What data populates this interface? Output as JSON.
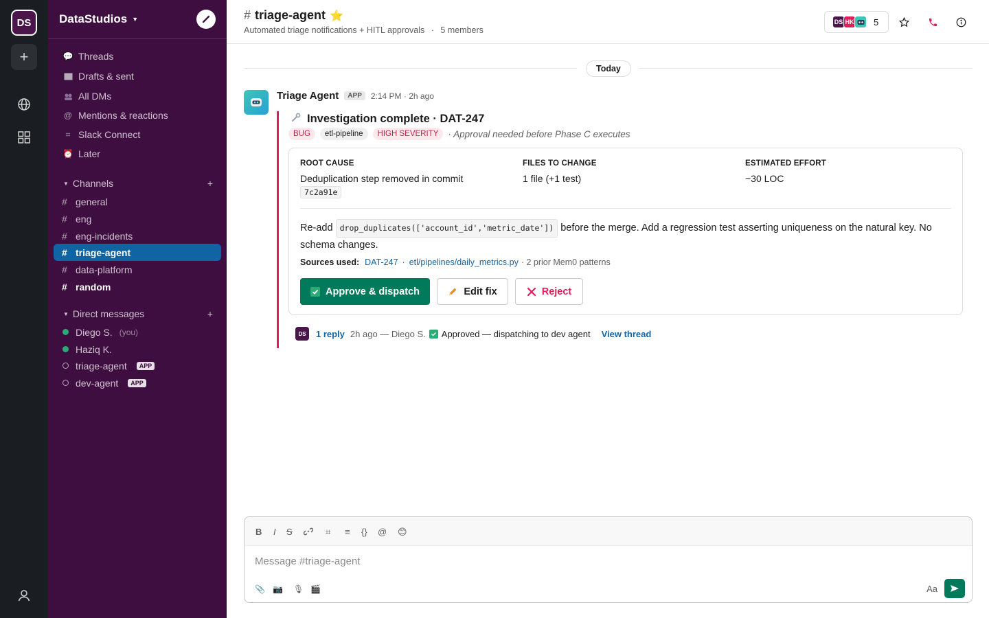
{
  "workspace": {
    "initials": "DS",
    "name": "DataStudios"
  },
  "sidebar": {
    "nav": [
      {
        "label": "Threads",
        "icon": "thread-icon"
      },
      {
        "label": "Drafts & sent",
        "icon": "drafts-icon"
      },
      {
        "label": "All DMs",
        "icon": "dms-icon"
      },
      {
        "label": "Mentions & reactions",
        "icon": "mention-icon"
      },
      {
        "label": "Slack Connect",
        "icon": "connect-icon"
      },
      {
        "label": "Later",
        "icon": "alarm-clock-icon"
      }
    ],
    "channels_title": "Channels",
    "channels": [
      {
        "name": "general"
      },
      {
        "name": "eng"
      },
      {
        "name": "eng-incidents"
      },
      {
        "name": "triage-agent"
      },
      {
        "name": "data-platform"
      },
      {
        "name": "random"
      }
    ],
    "dms_title": "Direct messages",
    "dms": [
      {
        "name": "Diego S.",
        "suffix": "(you)"
      },
      {
        "name": "Haziq K.",
        "suffix": ""
      },
      {
        "name": "triage-agent",
        "suffix": "APP"
      },
      {
        "name": "dev-agent",
        "suffix": "APP"
      }
    ]
  },
  "header": {
    "hash": "#",
    "channel": "triage-agent",
    "star": "⭐",
    "topic": "Automated triage notifications + HITL approvals",
    "dot": "·",
    "members_text": "5 members",
    "member_avatars": [
      "DS",
      "HK"
    ],
    "member_count": "5"
  },
  "divider": {
    "label": "Today"
  },
  "message": {
    "sender": "Triage Agent",
    "badge": "APP",
    "time": "2:14 PM · 2h ago",
    "title": "Investigation complete · DAT-247",
    "tags": {
      "bug": "BUG",
      "pipeline": "etl-pipeline",
      "severity": "HIGH SEVERITY"
    },
    "approval_note": "· Approval needed before Phase C executes",
    "fields": {
      "root_cause_label": "ROOT CAUSE",
      "root_cause_value": "Deduplication step removed in commit",
      "root_cause_commit": "7c2a91e",
      "files_label": "FILES TO CHANGE",
      "files_value": "1 file (+1 test)",
      "effort_label": "ESTIMATED EFFORT",
      "effort_value": "~30 LOC"
    },
    "fix": {
      "prefix": "Re-add",
      "code": "drop_duplicates(['account_id','metric_date'])",
      "suffix": "before the merge. Add a regression test asserting uniqueness on the natural key. No schema changes."
    },
    "sources": {
      "label": "Sources used:",
      "ticket": "DAT-247",
      "file": "etl/pipelines/daily_metrics.py",
      "patterns": "· 2 prior Mem0 patterns"
    },
    "buttons": {
      "approve": "Approve & dispatch",
      "edit": "Edit fix",
      "reject": "Reject"
    },
    "reply": {
      "avatar": "DS",
      "count": "1 reply",
      "meta": "2h ago — Diego S.",
      "status": "Approved — dispatching to dev agent",
      "view": "View thread"
    }
  },
  "composer": {
    "placeholder": "Message #triage-agent",
    "format": [
      "B",
      "I",
      "S"
    ],
    "aa": "Aa"
  },
  "colors": {
    "sidebar": "#3f0e40",
    "rail": "#1a1d21",
    "active_channel": "#1164a3",
    "approve": "#007a5a",
    "danger": "#e01e5a",
    "link": "#1264a3"
  }
}
